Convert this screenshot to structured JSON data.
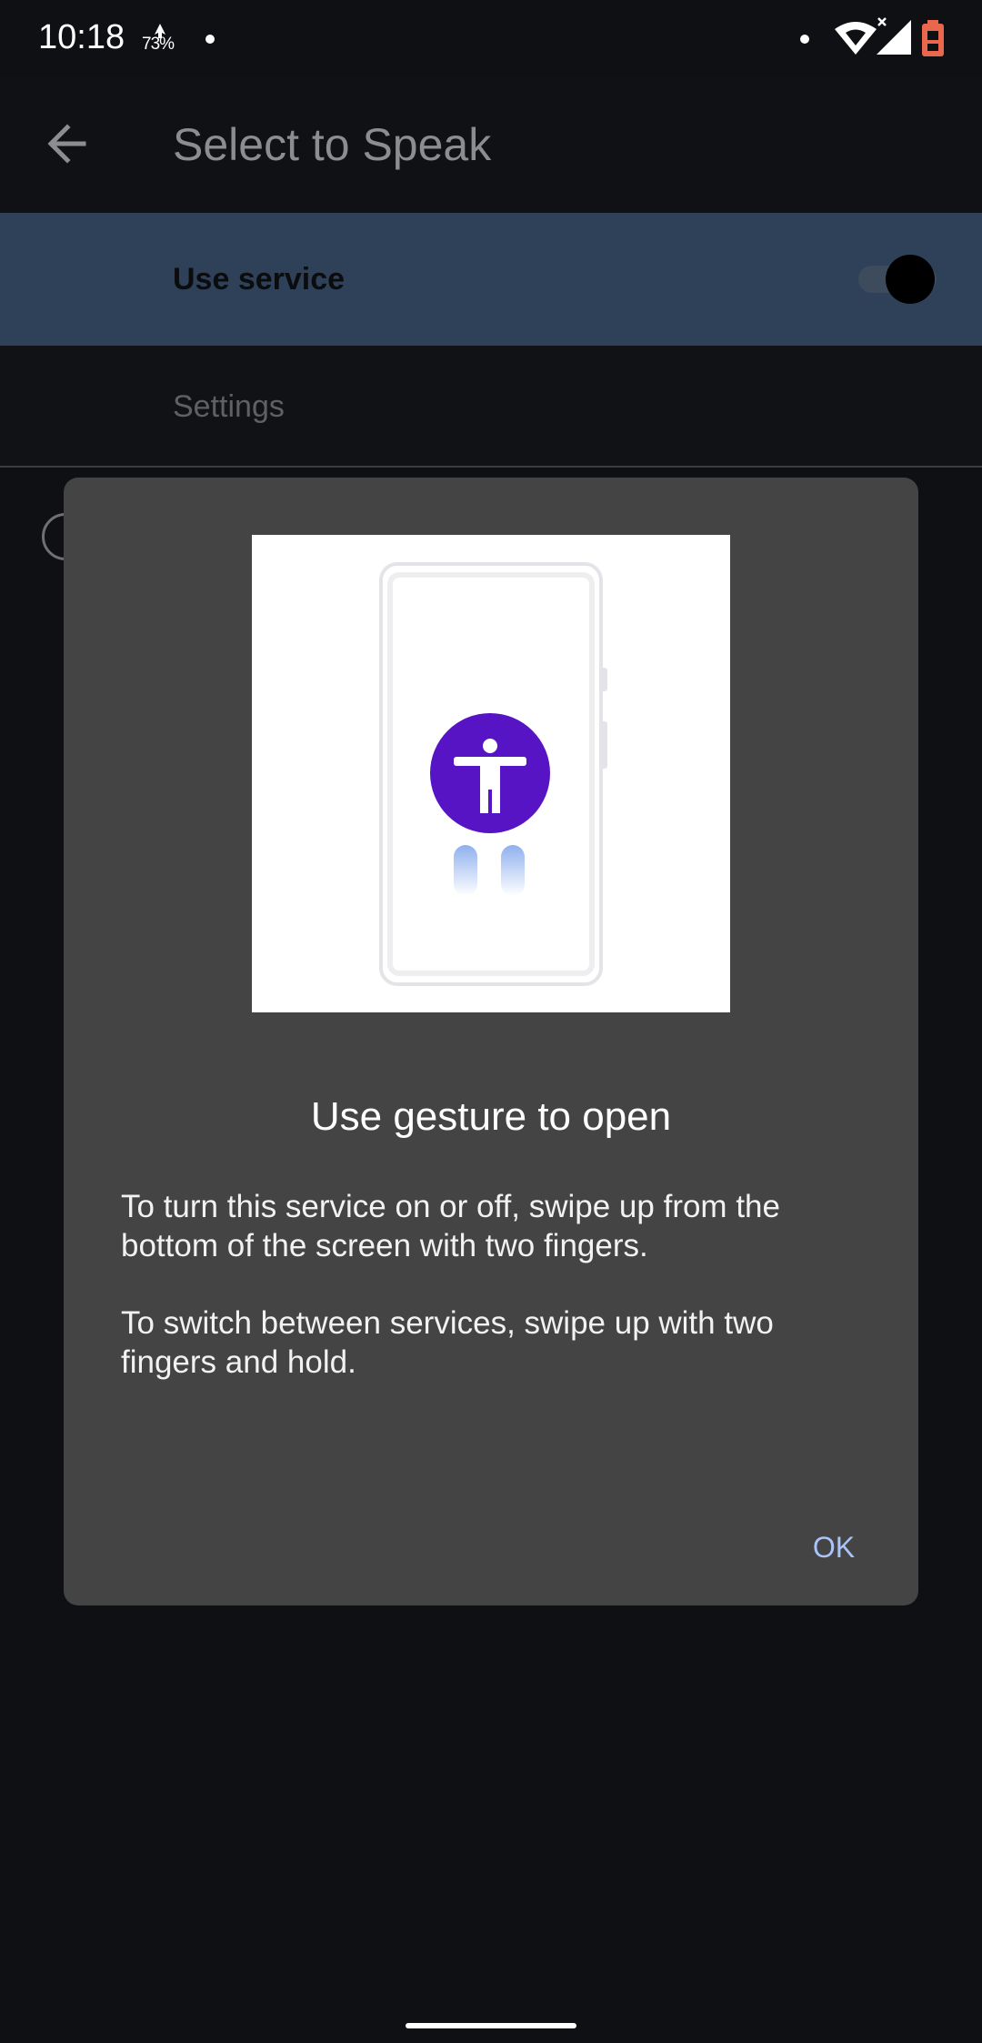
{
  "status_bar": {
    "time": "10:18",
    "data_usage": "73%",
    "icons": [
      "notification-dot-icon",
      "wifi-icon",
      "signal-icon",
      "battery-icon"
    ]
  },
  "toolbar": {
    "back_icon": "arrow-back-icon",
    "title": "Select to Speak"
  },
  "rows": {
    "use_service_label": "Use service",
    "use_service_on": true,
    "settings_label": "Settings"
  },
  "dialog": {
    "image_icon": "accessibility-icon",
    "title": "Use gesture to open",
    "text_1": "To turn this service on or off, swipe up from the bottom of the screen with two fingers.",
    "text_2": "To switch between services, swipe up with two fingers and hold.",
    "ok_label": "OK"
  },
  "colors": {
    "accent": "#a9c4f9",
    "accessibility_purple": "#5614c4",
    "highlight_row": "#2e4158",
    "dialog_bg": "#444445"
  }
}
